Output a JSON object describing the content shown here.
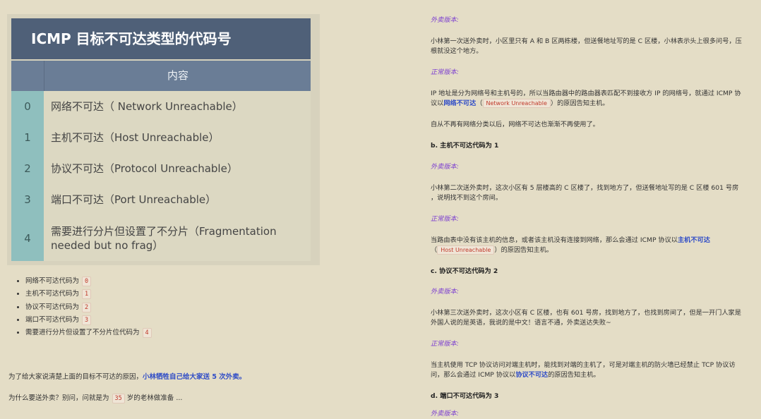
{
  "table": {
    "title": "ICMP 目标不可达类型的代码号",
    "header": "内容",
    "rows": [
      {
        "code": "0",
        "text": "网络不可达（ Network Unreachable）"
      },
      {
        "code": "1",
        "text": "主机不可达（Host Unreachable）"
      },
      {
        "code": "2",
        "text": "协议不可达（Protocol Unreachable）"
      },
      {
        "code": "3",
        "text": "端口不可达（Port Unreachable）"
      },
      {
        "code": "4",
        "text": "需要进行分片但设置了不分片（Fragmentation needed but no frag）"
      }
    ]
  },
  "list": [
    {
      "text": "网络不可达代码为",
      "code": "0"
    },
    {
      "text": "主机不可达代码为",
      "code": "1"
    },
    {
      "text": "协议不可达代码为",
      "code": "2"
    },
    {
      "text": "端口不可达代码为",
      "code": "3"
    },
    {
      "text": "需要进行分片但设置了不分片位代码为",
      "code": "4"
    }
  ],
  "intro": {
    "p1_text": "为了给大家说清楚上面的目标不可达的原因，",
    "p1_link": "小林牺牲自己给大家送 5 次外卖。",
    "p2_pre": "为什么要送外卖？别问，问就是为",
    "p2_num": "35",
    "p2_post": "岁的老林做准备 ..."
  },
  "right": {
    "l1": "外卖版本:",
    "p1": "小林第一次送外卖时，小区里只有 A 和 B 区两栋楼，但送餐地址写的是 C 区楼，小林表示头上很多问号，压根就没这个地方。",
    "l2": "正常版本:",
    "p2_pre": "IP 地址是分为网络号和主机号的，所以当路由器中的路由器表匹配不到接收方 IP 的网络号，就通过 ICMP 协议以",
    "p2_link": "网络不可达",
    "p2_open": "（",
    "p2_code": "Network Unreachable",
    "p2_post": "）的原因告知主机。",
    "p3": "自从不再有网络分类以后，网络不可达也渐渐不再使用了。",
    "h_b": "b. 主机不可达代码为 1",
    "l3": "外卖版本:",
    "p4": "小林第二次送外卖时，这次小区有 5 层楼高的 C 区楼了，找到地方了，但送餐地址写的是 C 区楼 601 号房 ，说明找不到这个房间。",
    "l4": "正常版本:",
    "p5_pre": "当路由表中没有该主机的信息，或者该主机没有连接到网络，那么会通过 ICMP 协议以",
    "p5_link": "主机不可达",
    "p5_open": "（",
    "p5_code": "Host Unreachable",
    "p5_post": "）的原因告知主机。",
    "h_c": "c. 协议不可达代码为 2",
    "l5": "外卖版本:",
    "p6": "小林第三次送外卖时，这次小区有 C 区楼，也有 601 号房，找到地方了，也找到房间了，但是一开门人家是外国人说的是英语，我说的是中文！语言不通，外卖送达失败~",
    "l6": "正常版本:",
    "p7_pre": "当主机使用 TCP 协议访问对端主机时，能找到对端的主机了，可是对端主机的防火墙已经禁止 TCP 协议访问，那么会通过 ICMP 协议以",
    "p7_link": "协议不可达",
    "p7_post": "的原因告知主机。",
    "h_d": "d. 端口不可达代码为 3",
    "l7": "外卖版本:"
  }
}
